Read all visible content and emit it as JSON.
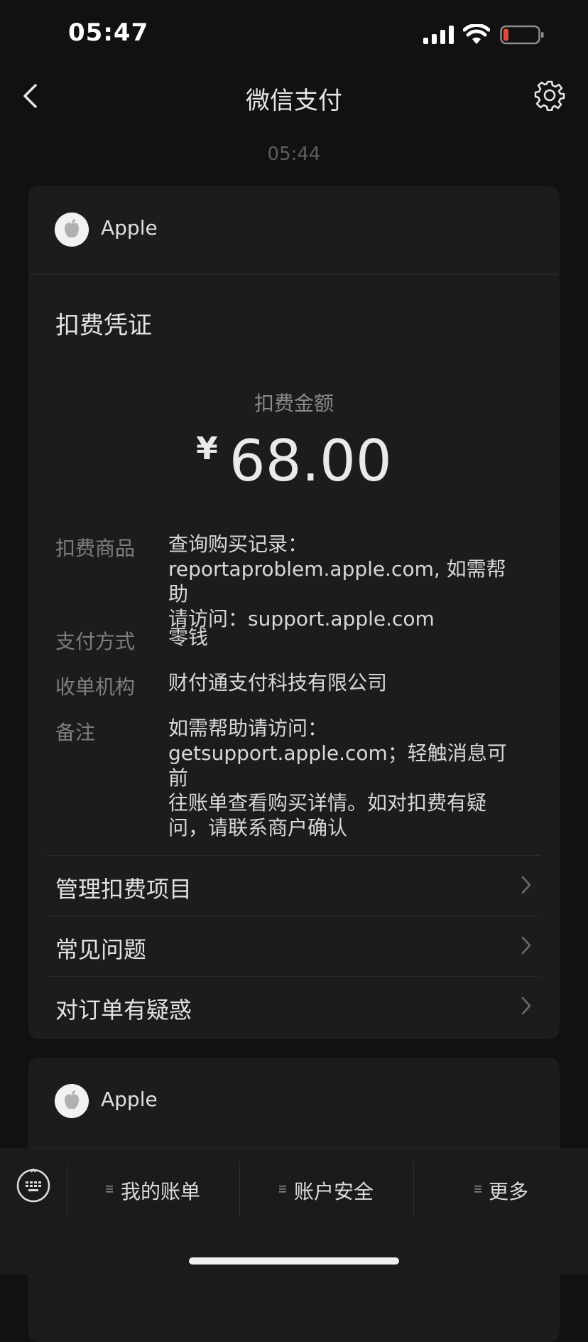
{
  "status_bar": {
    "time": "05:47",
    "battery_level": 0.15,
    "battery_color": "#e5473c"
  },
  "nav": {
    "title": "微信支付"
  },
  "message": {
    "time": "05:44"
  },
  "card": {
    "merchant": "Apple",
    "voucher_title": "扣费凭证",
    "amount_label": "扣费金额",
    "currency": "¥",
    "amount": "68.00",
    "details": [
      {
        "label": "扣费商品",
        "lines": [
          "查询购买记录：",
          "reportaproblem.apple.com, 如需帮助",
          "请访问：support.apple.com"
        ]
      },
      {
        "label": "支付方式",
        "lines": [
          "零钱"
        ]
      },
      {
        "label": "收单机构",
        "lines": [
          "财付通支付科技有限公司"
        ]
      },
      {
        "label": "备注",
        "lines": [
          "如需帮助请访问：",
          "getsupport.apple.com；轻触消息可前",
          "往账单查看购买详情。如对扣费有疑",
          "问，请联系商户确认"
        ]
      }
    ],
    "menu": [
      {
        "label": "管理扣费项目"
      },
      {
        "label": "常见问题"
      },
      {
        "label": "对订单有疑惑"
      }
    ]
  },
  "card2": {
    "merchant": "Apple"
  },
  "bottom_bar": {
    "tabs": [
      {
        "label": "我的账单"
      },
      {
        "label": "账户安全"
      },
      {
        "label": "更多"
      }
    ]
  },
  "icons": {
    "back": "chevron-left-icon",
    "settings": "gear-icon",
    "avatar": "apple-logo-icon",
    "menu_chevron": "chevron-right-icon",
    "keyboard": "keyboard-icon",
    "tab_menu": "menu-lines-icon"
  }
}
